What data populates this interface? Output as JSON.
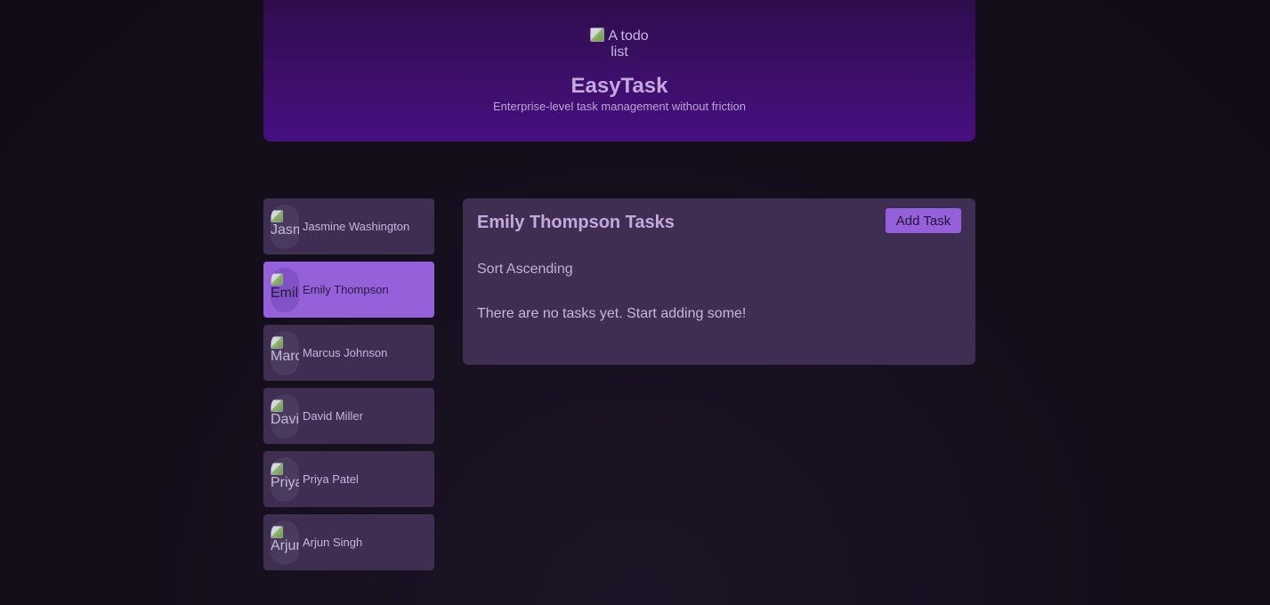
{
  "header": {
    "logo_alt": "A todo list",
    "title": "EasyTask",
    "subtitle": "Enterprise-level task management without friction"
  },
  "users": [
    {
      "name": "Jasmine Washington",
      "avatar_alt": "Jasmine Washington",
      "selected": false
    },
    {
      "name": "Emily Thompson",
      "avatar_alt": "Emily Thompson",
      "selected": true
    },
    {
      "name": "Marcus Johnson",
      "avatar_alt": "Marcus Johnson",
      "selected": false
    },
    {
      "name": "David Miller",
      "avatar_alt": "David Miller",
      "selected": false
    },
    {
      "name": "Priya Patel",
      "avatar_alt": "Priya Patel",
      "selected": false
    },
    {
      "name": "Arjun Singh",
      "avatar_alt": "Arjun Singh",
      "selected": false
    }
  ],
  "tasks": {
    "title": "Emily Thompson Tasks",
    "add_label": "Add Task",
    "sort_label": "Sort Ascending",
    "empty_message": "There are no tasks yet. Start adding some!"
  },
  "colors": {
    "accent": "#9461db",
    "card": "#3f2e52",
    "header_top": "#2e0d4c",
    "header_bottom": "#470f80"
  }
}
